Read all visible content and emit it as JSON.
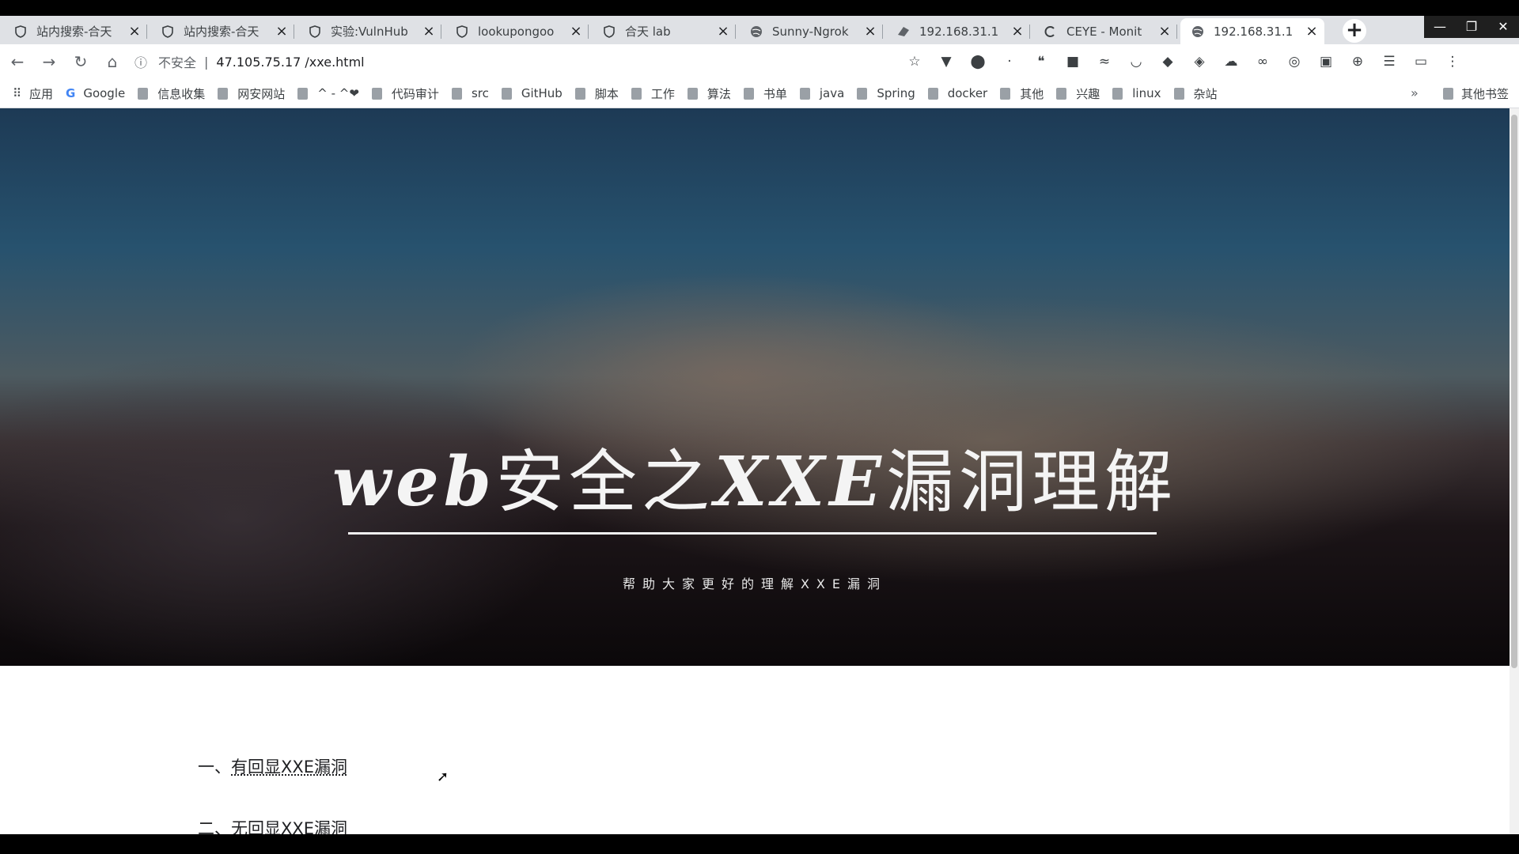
{
  "browser": {
    "tabs": [
      {
        "title": "站内搜索-合天",
        "icon": "shield-icon",
        "active": false
      },
      {
        "title": "站内搜索-合天",
        "icon": "shield-icon",
        "active": false
      },
      {
        "title": "实验:VulnHub",
        "icon": "shield-icon",
        "active": false
      },
      {
        "title": "lookupongoo",
        "icon": "shield-icon",
        "active": false
      },
      {
        "title": "合天 lab",
        "icon": "shield-icon",
        "active": false
      },
      {
        "title": "Sunny-Ngrok",
        "icon": "globe-icon",
        "active": false
      },
      {
        "title": "192.168.31.1",
        "icon": "page-icon",
        "active": false
      },
      {
        "title": "CEYE - Monit",
        "icon": "ceye-icon",
        "active": false
      },
      {
        "title": "192.168.31.1",
        "icon": "globe-icon",
        "active": true
      }
    ],
    "new_tab_label": "+",
    "window_controls": {
      "minimize": "—",
      "maximize": "❐",
      "close": "✕"
    },
    "address": {
      "security_label": "不安全",
      "url": "47.105.75.17 /xxe.html"
    },
    "extensions": [
      "star-icon",
      "vue-icon",
      "abp-icon",
      "extension-icon",
      "quote-icon",
      "cube-icon",
      "wifi-icon",
      "pocket-icon",
      "shield-icon",
      "diamond-icon",
      "cloud-icon",
      "swirl-icon",
      "ip-icon",
      "extension-icon",
      "extension-icon",
      "list-icon",
      "extension-icon",
      "menu-icon"
    ],
    "bookmarks": [
      {
        "label": "应用",
        "icon": "apps-icon"
      },
      {
        "label": "Google",
        "icon": "google-icon"
      },
      {
        "label": "信息收集",
        "icon": "folder-icon"
      },
      {
        "label": "网安网站",
        "icon": "folder-icon"
      },
      {
        "label": "^ - ^❤",
        "icon": "folder-icon"
      },
      {
        "label": "代码审计",
        "icon": "folder-icon"
      },
      {
        "label": "src",
        "icon": "folder-icon"
      },
      {
        "label": "GitHub",
        "icon": "folder-icon"
      },
      {
        "label": "脚本",
        "icon": "folder-icon"
      },
      {
        "label": "工作",
        "icon": "folder-icon"
      },
      {
        "label": "算法",
        "icon": "folder-icon"
      },
      {
        "label": "书单",
        "icon": "folder-icon"
      },
      {
        "label": "java",
        "icon": "folder-icon"
      },
      {
        "label": "Spring",
        "icon": "folder-icon"
      },
      {
        "label": "docker",
        "icon": "folder-icon"
      },
      {
        "label": "其他",
        "icon": "folder-icon"
      },
      {
        "label": "兴趣",
        "icon": "folder-icon"
      },
      {
        "label": "linux",
        "icon": "folder-icon"
      },
      {
        "label": "杂站",
        "icon": "folder-icon"
      }
    ],
    "bookmarks_more": "»",
    "other_bookmarks": "其他书签"
  },
  "page": {
    "hero": {
      "title_prefix": "web",
      "title_mid": "安全之",
      "title_key": "XXE",
      "title_suffix": "漏洞理解",
      "subtitle": "帮助大家更好的理解XXE漏洞"
    },
    "toc": [
      {
        "index": "一、",
        "text": "有回显XXE漏洞"
      },
      {
        "index": "二、",
        "text": "无回显XXE漏洞"
      }
    ]
  },
  "colors": {
    "tabstrip": "#dfe1e5",
    "hero_dark": "#0b080a",
    "hero_sky": "#27526e"
  }
}
